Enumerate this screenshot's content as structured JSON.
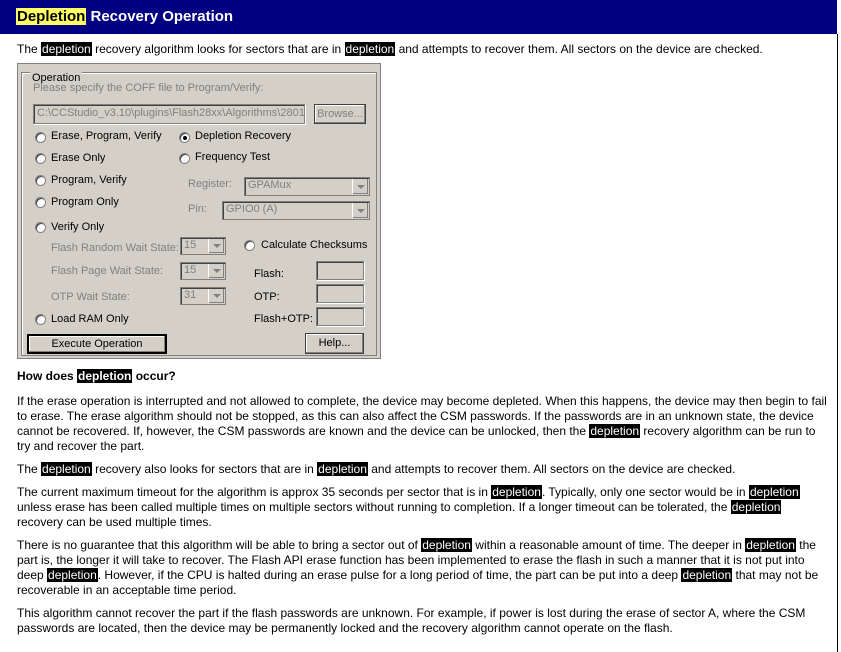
{
  "title": {
    "highlight": "Depletion",
    "rest": " Recovery Operation"
  },
  "intro": {
    "p1": "The ",
    "h1": "depletion",
    "p2": " recovery algorithm looks for sectors that are in ",
    "h2": "depletion",
    "p3": " and attempts to recover them.  All sectors on the device are checked."
  },
  "dialog": {
    "group_label": "Operation",
    "coff_label": "Please specify the COFF file to Program/Verify:",
    "coff_path": "C:\\CCStudio_v3.10\\plugins\\Flash28xx\\Algorithms\\2801",
    "browse": "Browse...",
    "options": {
      "erase_program_verify": "Erase, Program, Verify",
      "erase_only": "Erase Only",
      "program_verify": "Program, Verify",
      "program_only": "Program Only",
      "verify_only": "Verify Only",
      "load_ram_only": "Load RAM Only",
      "depletion_recovery": "Depletion Recovery",
      "frequency_test": "Frequency Test"
    },
    "selected": "depletion_recovery",
    "register_label": "Register:",
    "register_value": "GPAMux",
    "pin_label": "Pin:",
    "pin_value": "GPIO0 (A)",
    "flash_random_label": "Flash Random Wait State:",
    "flash_random_value": "15",
    "flash_page_label": "Flash Page Wait State:",
    "flash_page_value": "15",
    "otp_wait_label": "OTP Wait State:",
    "otp_wait_value": "31",
    "calc_checksums": "Calculate Checksums",
    "flash_label": "Flash:",
    "otp_label": "OTP:",
    "flash_otp_label": "Flash+OTP:",
    "execute": "Execute Operation",
    "help": "Help..."
  },
  "heading": {
    "p1": "How does ",
    "h1": "depletion",
    "p2": " occur?"
  },
  "para1": {
    "t1": "If the erase operation is interrupted and not allowed to complete, the device may become depleted. When this happens, the device may then begin to fail to erase. The erase algorithm should not be stopped, as this can also affect the CSM passwords. If the passwords are in an unknown state, the device cannot be recovered. If, however, the CSM passwords are known and the device can be unlocked, then the ",
    "h1": "depletion",
    "t2": " recovery algorithm can be run to try and recover the part."
  },
  "para2": {
    "t1": "The ",
    "h1": "depletion",
    "t2": " recovery also looks for sectors that are in ",
    "h2": "depletion",
    "t3": " and attempts to recover them. All sectors on the device are checked."
  },
  "para3": {
    "t1": "The current maximum timeout for the algorithm is approx 35 seconds per sector that is in ",
    "h1": "depletion",
    "t2": ".  Typically, only one sector would be in ",
    "h2": "depletion",
    "t3": " unless erase has been called multiple times on multiple sectors without running to completion. If a longer timeout can be tolerated, the ",
    "h3": "depletion",
    "t4": " recovery can be used multiple times."
  },
  "para4": {
    "t1": "There is no guarantee that this algorithm will be able to bring a sector out of ",
    "h1": "depletion",
    "t2": " within a reasonable amount of time. The deeper in ",
    "h2": "depletion",
    "t3": " the part is, the longer it will take to recover. The Flash API erase function has been implemented to erase the flash in such a manner that it is not put into deep ",
    "h3": "depletion",
    "t4": ". However, if the CPU is halted during an erase pulse for a long period of time, the part can be put into a deep ",
    "h4": "depletion",
    "t5": " that may not be recoverable in an acceptable time period."
  },
  "para5": {
    "t1": "This algorithm cannot recover the part if the flash passwords are unknown. For example, if power is lost during the erase of sector A, where the CSM passwords are located, then the device may be permanently locked and the recovery algorithm cannot operate on the flash."
  }
}
